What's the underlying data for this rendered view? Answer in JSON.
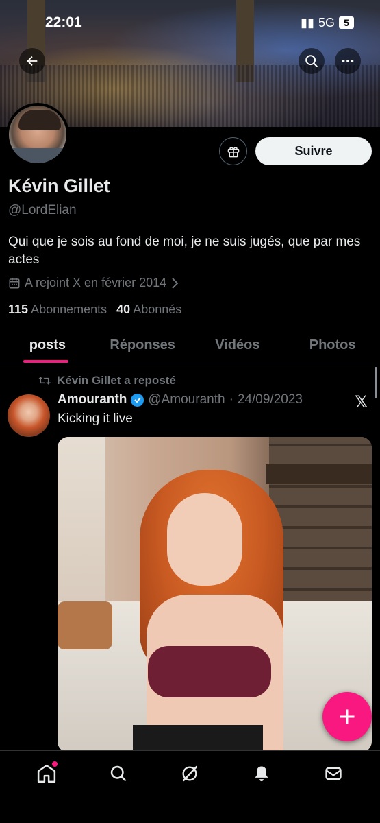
{
  "status": {
    "time": "22:01",
    "network": "5G",
    "battery": "5"
  },
  "profile": {
    "name": "Kévin Gillet",
    "handle": "@LordElian",
    "bio": "Qui que je sois au fond de moi, je ne suis jugés, que par mes actes",
    "joined": "A rejoint X en février 2014",
    "following_count": "115",
    "following_label": "Abonnements",
    "followers_count": "40",
    "followers_label": "Abonnés",
    "follow_label": "Suivre"
  },
  "tabs": [
    {
      "label": "posts",
      "active": true
    },
    {
      "label": "Réponses",
      "active": false
    },
    {
      "label": "Vidéos",
      "active": false
    },
    {
      "label": "Photos",
      "active": false
    }
  ],
  "post": {
    "repost_text": "Kévin Gillet a reposté",
    "author": "Amouranth",
    "author_handle": "@Amouranth",
    "separator": "·",
    "date": "24/09/2023",
    "text": "Kicking it live",
    "source_logo": "𝕏"
  },
  "icons": {
    "back": "back-arrow-icon",
    "search": "search-icon",
    "more": "more-icon",
    "gift": "gift-icon",
    "calendar": "calendar-icon",
    "repost": "repost-icon",
    "verified": "verified-badge-icon",
    "compose": "plus-icon",
    "nav": [
      "home-icon",
      "search-icon",
      "grok-icon",
      "notifications-icon",
      "messages-icon"
    ]
  },
  "colors": {
    "accent": "#f91880",
    "verified": "#1d9bf0",
    "muted": "#71767b"
  }
}
